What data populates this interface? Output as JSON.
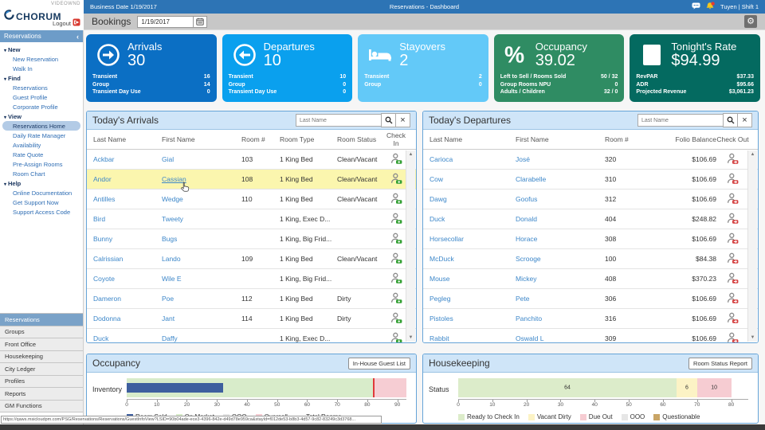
{
  "header": {
    "logo": {
      "brand": "CHORUM",
      "watermark": "VIDEOWND",
      "logout_label": "Logout"
    },
    "topbar": {
      "business_date": "Business Date 1/19/2017",
      "title": "Reservations - Dashboard",
      "user": "Tuyen | Shift 1"
    },
    "toolbar": {
      "section_label": "Bookings",
      "date_value": "1/19/2017"
    }
  },
  "sidebar": {
    "panel_title": "Reservations",
    "collapse_icon": "chevron-left",
    "sections": [
      {
        "label": "New",
        "items": [
          "New Reservation",
          "Walk In"
        ]
      },
      {
        "label": "Find",
        "items": [
          "Reservations",
          "Guest Profile",
          "Corporate Profile"
        ]
      },
      {
        "label": "View",
        "items": [
          "Reservations Home",
          "Daily Rate Manager",
          "Availability",
          "Rate Quote",
          "Pre-Assign Rooms",
          "Room Chart"
        ]
      },
      {
        "label": "Help",
        "items": [
          "Online Documentation",
          "Get Support Now",
          "Support Access Code"
        ]
      }
    ],
    "selected_item": "Reservations Home",
    "modules": [
      "Reservations",
      "Groups",
      "Front Office",
      "Housekeeping",
      "City Ledger",
      "Profiles",
      "Reports",
      "GM Functions"
    ],
    "active_module": "Reservations"
  },
  "kpi_cards": [
    {
      "title": "Arrivals",
      "value": "30",
      "icon": "arrow-right-circle-icon",
      "color": "#0b6fc4",
      "details": [
        [
          "Transient",
          "16"
        ],
        [
          "Group",
          "14"
        ],
        [
          "Transient Day Use",
          "0"
        ]
      ]
    },
    {
      "title": "Departures",
      "value": "10",
      "icon": "arrow-left-circle-icon",
      "color": "#0aa0ee",
      "details": [
        [
          "Transient",
          "10"
        ],
        [
          "Group",
          "0"
        ],
        [
          "Transient Day Use",
          "0"
        ]
      ]
    },
    {
      "title": "Stayovers",
      "value": "2",
      "icon": "bed-icon",
      "color": "#63c9f8",
      "details": [
        [
          "Transient",
          "2"
        ],
        [
          "Group",
          "0"
        ]
      ]
    },
    {
      "title": "Occupancy",
      "value": "39.02",
      "icon": "percent-icon",
      "color": "#2f8c63",
      "details": [
        [
          "Left to Sell / Rooms Sold",
          "50 / 32"
        ],
        [
          "Group Rooms NPU",
          "0"
        ],
        [
          "Adults / Children",
          "32 / 0"
        ]
      ]
    },
    {
      "title": "Tonight's Rate",
      "value": "$94.99",
      "icon": "building-icon",
      "color": "#046a60",
      "details": [
        [
          "RevPAR",
          "$37.33"
        ],
        [
          "ADR",
          "$95.66"
        ],
        [
          "Projected Revenue",
          "$3,061.23"
        ]
      ]
    }
  ],
  "arrivals_panel": {
    "title": "Today's Arrivals",
    "search_placeholder": "Last Name",
    "columns": [
      "Last Name",
      "First Name",
      "Room #",
      "Room Type",
      "Room Status",
      "Check In"
    ],
    "rows": [
      {
        "last": "Ackbar",
        "first": "Gial",
        "room": "103",
        "type": "1 King Bed",
        "status": "Clean/Vacant"
      },
      {
        "last": "Andor",
        "first": "Cassian",
        "room": "108",
        "type": "1 King Bed",
        "status": "Clean/Vacant",
        "highlighted": true,
        "hovered": true
      },
      {
        "last": "Antilles",
        "first": "Wedge",
        "room": "110",
        "type": "1 King Bed",
        "status": "Clean/Vacant"
      },
      {
        "last": "Bird",
        "first": "Tweety",
        "room": "",
        "type": "1 King, Exec D...",
        "status": ""
      },
      {
        "last": "Bunny",
        "first": "Bugs",
        "room": "",
        "type": "1 King, Big Frid...",
        "status": ""
      },
      {
        "last": "Calrissian",
        "first": "Lando",
        "room": "109",
        "type": "1 King Bed",
        "status": "Clean/Vacant"
      },
      {
        "last": "Coyote",
        "first": "Wile E",
        "room": "",
        "type": "1 King, Big Frid...",
        "status": ""
      },
      {
        "last": "Dameron",
        "first": "Poe",
        "room": "112",
        "type": "1 King Bed",
        "status": "Dirty"
      },
      {
        "last": "Dodonna",
        "first": "Jant",
        "room": "114",
        "type": "1 King Bed",
        "status": "Dirty"
      },
      {
        "last": "Duck",
        "first": "Daffy",
        "room": "",
        "type": "1 King, Exec D...",
        "status": ""
      }
    ]
  },
  "departures_panel": {
    "title": "Today's Departures",
    "search_placeholder": "Last Name",
    "columns": [
      "Last Name",
      "First Name",
      "Room #",
      "Folio Balance",
      "Check Out"
    ],
    "rows": [
      {
        "last": "Carioca",
        "first": "José",
        "room": "320",
        "balance": "$106.69"
      },
      {
        "last": "Cow",
        "first": "Clarabelle",
        "room": "310",
        "balance": "$106.69"
      },
      {
        "last": "Dawg",
        "first": "Goofus",
        "room": "312",
        "balance": "$106.69"
      },
      {
        "last": "Duck",
        "first": "Donald",
        "room": "404",
        "balance": "$248.82"
      },
      {
        "last": "Horsecollar",
        "first": "Horace",
        "room": "308",
        "balance": "$106.69"
      },
      {
        "last": "McDuck",
        "first": "Scrooge",
        "room": "100",
        "balance": "$84.38"
      },
      {
        "last": "Mouse",
        "first": "Mickey",
        "room": "408",
        "balance": "$370.23"
      },
      {
        "last": "Pegleg",
        "first": "Pete",
        "room": "306",
        "balance": "$106.69"
      },
      {
        "last": "Pistoles",
        "first": "Panchito",
        "room": "316",
        "balance": "$106.69"
      },
      {
        "last": "Rabbit",
        "first": "Oswald L",
        "room": "309",
        "balance": "$106.69"
      }
    ]
  },
  "occupancy_panel": {
    "title": "Occupancy",
    "button_label": "In-House Guest List"
  },
  "housekeeping_panel": {
    "title": "Housekeeping",
    "button_label": "Room Status Report"
  },
  "chart_data": [
    {
      "type": "bar",
      "title": "Occupancy",
      "categories": [
        "Inventory"
      ],
      "xlim": [
        0,
        93
      ],
      "ticks": [
        0,
        10,
        20,
        30,
        40,
        50,
        60,
        70,
        80,
        90
      ],
      "series": [
        {
          "name": "Room Sold",
          "values": [
            32
          ],
          "color": "#3e5f9e",
          "style": "bar"
        },
        {
          "name": "On Market",
          "values": [
            82
          ],
          "color": "#d8ecca",
          "style": "region"
        },
        {
          "name": "OOO",
          "values": [
            0
          ],
          "color": "#e6e6e6",
          "style": "region"
        },
        {
          "name": "Oversell",
          "values": [
            11
          ],
          "color": "#f6cdd3",
          "style": "region"
        },
        {
          "name": "Total Rooms",
          "values": [
            82
          ],
          "color": "#e03a3a",
          "style": "line"
        }
      ],
      "legend_position": "bottom",
      "grid": false
    },
    {
      "type": "bar",
      "title": "Housekeeping",
      "categories": [
        "Status"
      ],
      "xlim": [
        0,
        85
      ],
      "ticks": [
        0,
        10,
        20,
        30,
        40,
        50,
        60,
        70,
        80
      ],
      "series": [
        {
          "name": "Ready to Check In",
          "values": [
            64
          ],
          "color": "#dcecca",
          "style": "stacked"
        },
        {
          "name": "Vacant Dirty",
          "values": [
            6
          ],
          "color": "#fcf3c5",
          "style": "stacked"
        },
        {
          "name": "Due Out",
          "values": [
            10
          ],
          "color": "#f6ccd2",
          "style": "stacked"
        },
        {
          "name": "OOO",
          "values": [
            0
          ],
          "color": "#e6e6e6",
          "style": "stacked"
        },
        {
          "name": "Questionable",
          "values": [
            0
          ],
          "color": "#c9a566",
          "style": "stacked"
        }
      ],
      "legend_position": "bottom",
      "grid": false
    }
  ],
  "statusbar": {
    "url": "https://qaws.msicloudpm.com/PSG/Reservations/Reservations/GuestInfoView?LSID=90b04ade-ece3-4396-842e-d49d78e959ca&stayId=f012de53-b8b3-4d57-9c82-83249c3d3768..."
  }
}
